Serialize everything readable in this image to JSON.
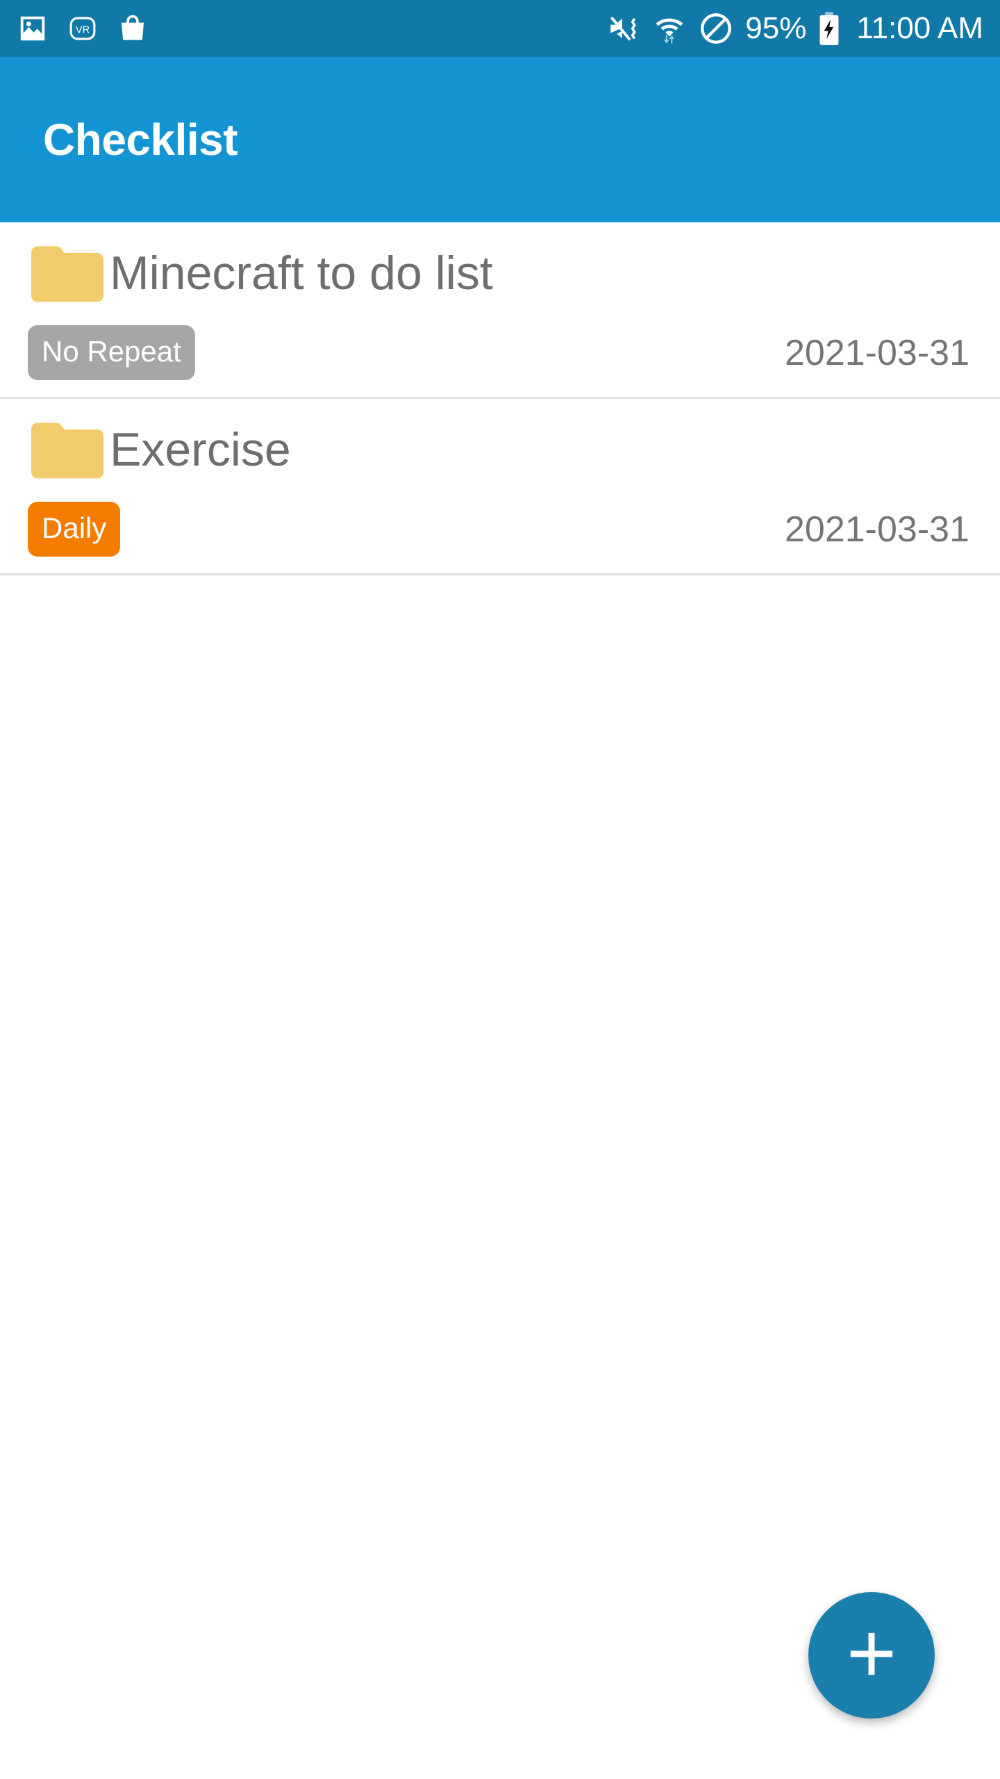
{
  "status_bar": {
    "left_icons": [
      {
        "name": "gallery-image-icon"
      },
      {
        "name": "vr-badge-icon"
      },
      {
        "name": "shopping-bag-icon"
      }
    ],
    "right_icons": [
      {
        "name": "vibrate-mute-icon"
      },
      {
        "name": "wifi-data-transfer-icon"
      },
      {
        "name": "do-not-disturb-icon"
      }
    ],
    "battery_percent": "95%",
    "battery_icon": "battery-charging-icon",
    "clock": "11:00 AM"
  },
  "app_bar": {
    "title": "Checklist"
  },
  "list": {
    "items": [
      {
        "icon": "folder-icon",
        "title": "Minecraft to do list",
        "badge": "No Repeat",
        "badge_type": "norepeat",
        "date": "2021-03-31"
      },
      {
        "icon": "folder-icon",
        "title": "Exercise",
        "badge": "Daily",
        "badge_type": "daily",
        "date": "2021-03-31"
      }
    ]
  },
  "fab": {
    "icon": "plus-icon",
    "label": "+"
  },
  "colors": {
    "status_bar": "#1179A8",
    "app_bar": "#1494D3",
    "fab": "#1B7FAD",
    "folder": "#F2CC6A",
    "badge_norepeat": "#A6A6A6",
    "badge_daily": "#F57C00",
    "title_text": "#6E6E6E",
    "date_text": "#757575",
    "divider": "#E0E0E0"
  }
}
